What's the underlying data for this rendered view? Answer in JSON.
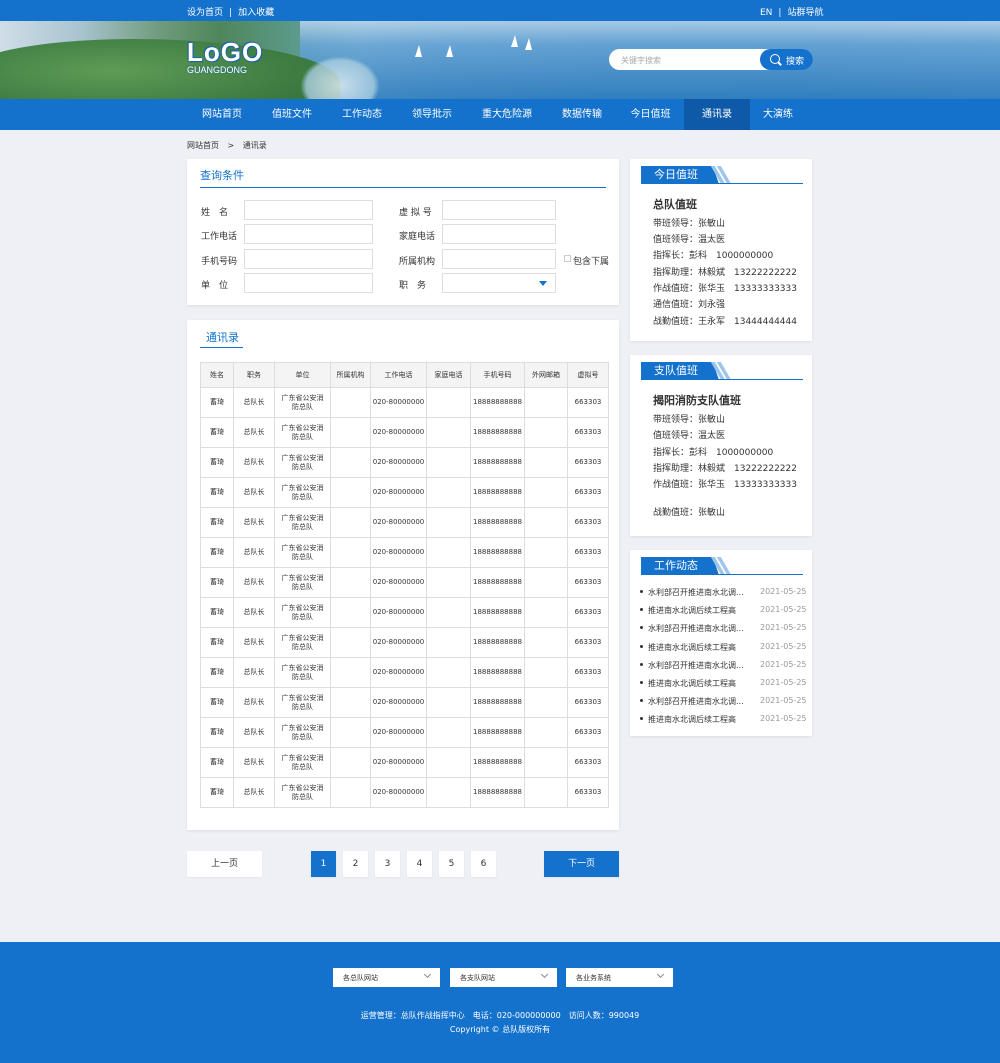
{
  "topbar": {
    "set_home": "设为首页",
    "favorite": "加入收藏",
    "sep": "|",
    "lang": "EN",
    "site_nav": "站群导航"
  },
  "logo": {
    "main": "LoGO",
    "sub": "GUANGDONG"
  },
  "search": {
    "placeholder": "关键字搜索",
    "button": "搜索"
  },
  "nav": {
    "items": [
      "网站首页",
      "值班文件",
      "工作动态",
      "领导批示",
      "重大危险源",
      "数据传输",
      "今日值班",
      "通讯录",
      "大演练"
    ],
    "active_index": 7
  },
  "breadcrumb": {
    "home": "网站首页",
    "sep": ">",
    "current": "通讯录"
  },
  "query": {
    "title": "查询条件",
    "fields": {
      "name": "姓　名",
      "virtual": "虚 拟 号",
      "work_phone": "工作电话",
      "home_phone": "家庭电话",
      "mobile": "手机号码",
      "org": "所属机构",
      "unit": "单　位",
      "position": "职　务"
    },
    "include_sub": "包含下属"
  },
  "directory": {
    "title": "通讯录",
    "columns": [
      "姓名",
      "职务",
      "单位",
      "所属机构",
      "工作电话",
      "家庭电话",
      "手机号码",
      "外网邮箱",
      "虚拟号"
    ],
    "rows": [
      [
        "蓄琦",
        "总队长",
        "广东省公安消防总队",
        "",
        "020-80000000",
        "",
        "18888888888",
        "",
        "663303"
      ],
      [
        "蓄琦",
        "总队长",
        "广东省公安消防总队",
        "",
        "020-80000000",
        "",
        "18888888888",
        "",
        "663303"
      ],
      [
        "蓄琦",
        "总队长",
        "广东省公安消防总队",
        "",
        "020-80000000",
        "",
        "18888888888",
        "",
        "663303"
      ],
      [
        "蓄琦",
        "总队长",
        "广东省公安消防总队",
        "",
        "020-80000000",
        "",
        "18888888888",
        "",
        "663303"
      ],
      [
        "蓄琦",
        "总队长",
        "广东省公安消防总队",
        "",
        "020-80000000",
        "",
        "18888888888",
        "",
        "663303"
      ],
      [
        "蓄琦",
        "总队长",
        "广东省公安消防总队",
        "",
        "020-80000000",
        "",
        "18888888888",
        "",
        "663303"
      ],
      [
        "蓄琦",
        "总队长",
        "广东省公安消防总队",
        "",
        "020-80000000",
        "",
        "18888888888",
        "",
        "663303"
      ],
      [
        "蓄琦",
        "总队长",
        "广东省公安消防总队",
        "",
        "020-80000000",
        "",
        "18888888888",
        "",
        "663303"
      ],
      [
        "蓄琦",
        "总队长",
        "广东省公安消防总队",
        "",
        "020-80000000",
        "",
        "18888888888",
        "",
        "663303"
      ],
      [
        "蓄琦",
        "总队长",
        "广东省公安消防总队",
        "",
        "020-80000000",
        "",
        "18888888888",
        "",
        "663303"
      ],
      [
        "蓄琦",
        "总队长",
        "广东省公安消防总队",
        "",
        "020-80000000",
        "",
        "18888888888",
        "",
        "663303"
      ],
      [
        "蓄琦",
        "总队长",
        "广东省公安消防总队",
        "",
        "020-80000000",
        "",
        "18888888888",
        "",
        "663303"
      ],
      [
        "蓄琦",
        "总队长",
        "广东省公安消防总队",
        "",
        "020-80000000",
        "",
        "18888888888",
        "",
        "663303"
      ],
      [
        "蓄琦",
        "总队长",
        "广东省公安消防总队",
        "",
        "020-80000000",
        "",
        "18888888888",
        "",
        "663303"
      ]
    ]
  },
  "pagination": {
    "prev": "上一页",
    "next": "下一页",
    "pages": [
      "1",
      "2",
      "3",
      "4",
      "5",
      "6"
    ],
    "current": "1"
  },
  "today_duty": {
    "title": "今日值班",
    "subtitle": "总队值班",
    "lines": [
      "带班领导：张敏山",
      "值班领导：温太医",
      "指挥长：彭科　1000000000",
      "指挥助理：林毅斌　13222222222",
      "作战值班：张华玉　13333333333",
      "通信值班：刘永强",
      "战勤值班：王永军　13444444444"
    ]
  },
  "branch_duty": {
    "title": "支队值班",
    "subtitle": "揭阳消防支队值班",
    "lines": [
      "带班领导：张敏山",
      "值班领导：温太医",
      "指挥长：彭科　1000000000",
      "指挥助理：林毅斌　13222222222",
      "作战值班：张华玉　13333333333",
      "战勤值班：张敏山"
    ]
  },
  "work_news": {
    "title": "工作动态",
    "items": [
      {
        "text": "水利部召开推进南水北调...",
        "date": "2021-05-25"
      },
      {
        "text": "推进南水北调后续工程高",
        "date": "2021-05-25"
      },
      {
        "text": "水利部召开推进南水北调...",
        "date": "2021-05-25"
      },
      {
        "text": "推进南水北调后续工程高",
        "date": "2021-05-25"
      },
      {
        "text": "水利部召开推进南水北调...",
        "date": "2021-05-25"
      },
      {
        "text": "推进南水北调后续工程高",
        "date": "2021-05-25"
      },
      {
        "text": "水利部召开推进南水北调...",
        "date": "2021-05-25"
      },
      {
        "text": "推进南水北调后续工程高",
        "date": "2021-05-25"
      }
    ]
  },
  "footer": {
    "selects": [
      "各总队网站",
      "各支队网站",
      "各业务系统"
    ],
    "info": "运营管理：总队作战指挥中心　电话：020-000000000　访问人数：990049",
    "copyright": "Copyright © 总队版权所有"
  },
  "colors": {
    "primary": "#1472cc",
    "nav_active": "#0e5aa8",
    "background": "#eef0f5"
  }
}
